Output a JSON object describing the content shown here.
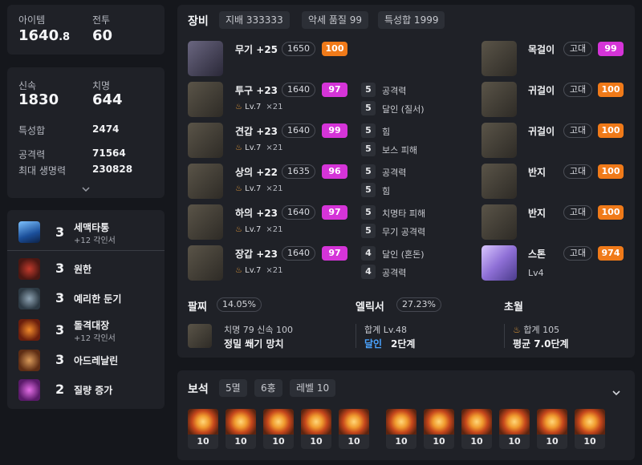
{
  "summary": {
    "item_label": "아이템",
    "item_value": "1640",
    "item_decimal": ".8",
    "battle_label": "전투",
    "battle_value": "60"
  },
  "stats": {
    "crit_spec": [
      {
        "label": "신속",
        "value": "1830"
      },
      {
        "label": "치명",
        "value": "644"
      }
    ],
    "total_label": "특성합",
    "total_value": "2474",
    "attack_label": "공격력",
    "attack_value": "71564",
    "hp_label": "최대 생명력",
    "hp_value": "230828"
  },
  "engravings": [
    {
      "level": "3",
      "name": "세맥타통",
      "sub": "+12 각인서",
      "icon": "meridian-icon"
    },
    {
      "level": "3",
      "name": "원한",
      "sub": "",
      "icon": "grudge-icon"
    },
    {
      "level": "3",
      "name": "예리한 둔기",
      "sub": "",
      "icon": "keen-blunt-icon"
    },
    {
      "level": "3",
      "name": "돌격대장",
      "sub": "+12 각인서",
      "icon": "raid-captain-icon"
    },
    {
      "level": "3",
      "name": "아드레날린",
      "sub": "",
      "icon": "adrenaline-icon"
    },
    {
      "level": "2",
      "name": "질량 증가",
      "sub": "",
      "icon": "mass-increase-icon"
    }
  ],
  "equipment_header": {
    "title": "장비",
    "chips": [
      "지배 333333",
      "악세 품질 99",
      "특성합 1999"
    ]
  },
  "armor": [
    {
      "name": "무기 +25",
      "ilvl": "1650",
      "quality": "100",
      "qcolor": "orange",
      "lv": "",
      "x": "",
      "effects": []
    },
    {
      "name": "투구 +23",
      "ilvl": "1640",
      "quality": "97",
      "qcolor": "pink",
      "lv": "Lv.7",
      "x": "×21",
      "effects": [
        {
          "n": "5",
          "t": "공격력"
        },
        {
          "n": "5",
          "t": "달인 (질서)"
        }
      ]
    },
    {
      "name": "견갑 +23",
      "ilvl": "1640",
      "quality": "99",
      "qcolor": "pink",
      "lv": "Lv.7",
      "x": "×21",
      "effects": [
        {
          "n": "5",
          "t": "힘"
        },
        {
          "n": "5",
          "t": "보스 피해"
        }
      ]
    },
    {
      "name": "상의 +22",
      "ilvl": "1635",
      "quality": "96",
      "qcolor": "pink",
      "lv": "Lv.7",
      "x": "×21",
      "effects": [
        {
          "n": "5",
          "t": "공격력"
        },
        {
          "n": "5",
          "t": "힘"
        }
      ]
    },
    {
      "name": "하의 +23",
      "ilvl": "1640",
      "quality": "97",
      "qcolor": "pink",
      "lv": "Lv.7",
      "x": "×21",
      "effects": [
        {
          "n": "5",
          "t": "치명타 피해"
        },
        {
          "n": "5",
          "t": "무기 공격력"
        }
      ]
    },
    {
      "name": "장갑 +23",
      "ilvl": "1640",
      "quality": "97",
      "qcolor": "pink",
      "lv": "Lv.7",
      "x": "×21",
      "effects": [
        {
          "n": "4",
          "t": "달인 (혼돈)"
        },
        {
          "n": "4",
          "t": "공격력"
        }
      ]
    }
  ],
  "accessories": [
    {
      "name": "목걸이",
      "grade": "고대",
      "quality": "99",
      "qcolor": "pink"
    },
    {
      "name": "귀걸이",
      "grade": "고대",
      "quality": "100",
      "qcolor": "orange"
    },
    {
      "name": "귀걸이",
      "grade": "고대",
      "quality": "100",
      "qcolor": "orange"
    },
    {
      "name": "반지",
      "grade": "고대",
      "quality": "100",
      "qcolor": "orange"
    },
    {
      "name": "반지",
      "grade": "고대",
      "quality": "100",
      "qcolor": "orange"
    },
    {
      "name": "스톤",
      "grade": "고대",
      "quality": "974",
      "qcolor": "orange",
      "extra": "Lv4"
    }
  ],
  "bracelet": {
    "title": "팔찌",
    "chip": "14.05%",
    "line1": "치명 79  신속 100",
    "line2": "정밀  쐐기  망치"
  },
  "elixir": {
    "title": "엘릭서",
    "chip": "27.23%",
    "line1": "합계 Lv.48",
    "line2_a": "달인",
    "line2_b": "2단계"
  },
  "transcend": {
    "title": "초월",
    "line1": "합계 105",
    "line2": "평균 7.0단계"
  },
  "gems": {
    "title": "보석",
    "chips": [
      "5멸",
      "6홍",
      "레벨 10"
    ],
    "levels": [
      "10",
      "10",
      "10",
      "10",
      "10",
      "10",
      "10",
      "10",
      "10",
      "10",
      "10"
    ]
  },
  "colors": {
    "accent_pink": "#d534d8",
    "accent_orange": "#f07a19",
    "panel": "#1f2127",
    "bg": "#15171c"
  }
}
